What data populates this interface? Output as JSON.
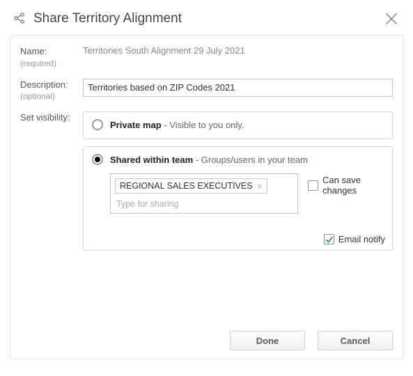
{
  "header": {
    "title": "Share Territory Alignment"
  },
  "labels": {
    "name": "Name:",
    "name_hint": "(required)",
    "description": "Description:",
    "description_hint": "(optional)",
    "visibility": "Set visibility:"
  },
  "name_value": "Territories South Alignment 29 July 2021",
  "description_value": "Territories based on ZIP Codes 2021",
  "visibility": {
    "private": {
      "title": "Private map",
      "hint": " - Visible to you only.",
      "selected": false
    },
    "shared": {
      "title": "Shared within team",
      "hint": " - Groups/users in your team",
      "selected": true,
      "tokens": [
        "REGIONAL SALES EXECUTIVES"
      ],
      "placeholder": "Type for sharing",
      "can_save_label": "Can save changes",
      "can_save_checked": false,
      "email_notify_label": "Email notify",
      "email_notify_checked": true
    }
  },
  "buttons": {
    "done": "Done",
    "cancel": "Cancel"
  }
}
